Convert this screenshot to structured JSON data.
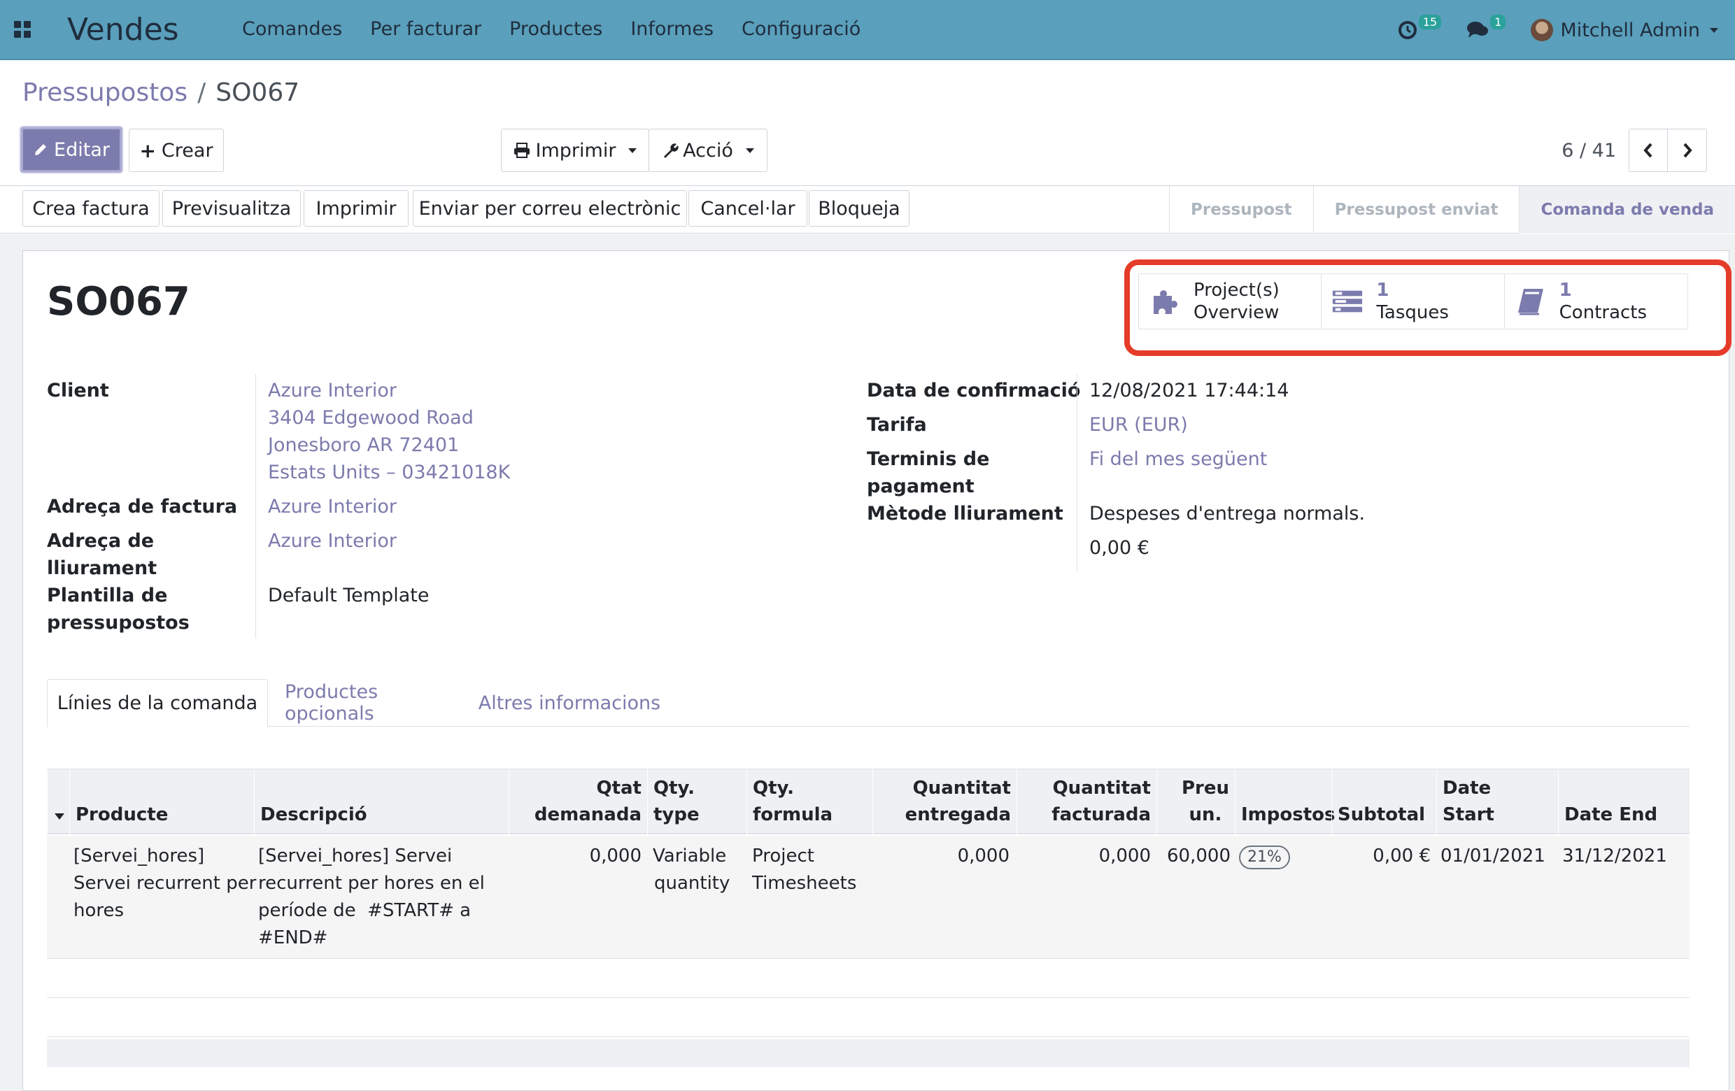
{
  "navbar": {
    "app_name": "Vendes",
    "menu": [
      "Comandes",
      "Per facturar",
      "Productes",
      "Informes",
      "Configuració"
    ],
    "activity_count": "15",
    "message_count": "1",
    "user_name": "Mitchell Admin"
  },
  "breadcrumb": {
    "parent": "Pressupostos",
    "separator": "/",
    "current": "SO067"
  },
  "actions": {
    "edit": "Editar",
    "create": "Crear",
    "print": "Imprimir",
    "action": "Acció"
  },
  "pager": {
    "value": "6 / 41"
  },
  "statusbar": {
    "buttons": [
      "Crea factura",
      "Previsualitza",
      "Imprimir",
      "Enviar per correu electrònic",
      "Cancel·lar",
      "Bloqueja"
    ],
    "stages": [
      "Pressupost",
      "Pressupost enviat",
      "Comanda de venda"
    ],
    "active_stage": "Comanda de venda"
  },
  "record": {
    "name": "SO067"
  },
  "smart_buttons": [
    {
      "line1": "Project(s)",
      "line2": "Overview",
      "icon": "puzzle-icon"
    },
    {
      "value": "1",
      "label": "Tasques",
      "icon": "tasks-icon"
    },
    {
      "value": "1",
      "label": "Contracts",
      "icon": "book-icon"
    }
  ],
  "fields_left": {
    "client_label": "Client",
    "client_lines": [
      "Azure Interior",
      "3404 Edgewood Road",
      "Jonesboro AR 72401",
      "Estats Units – 03421018K"
    ],
    "invoice_address_label": "Adreça de factura",
    "invoice_address": "Azure Interior",
    "delivery_address_label_1": "Adreça de",
    "delivery_address_label_2": "lliurament",
    "delivery_address": "Azure Interior",
    "template_label_1": "Plantilla de",
    "template_label_2": "pressupostos",
    "template": "Default Template"
  },
  "fields_right": {
    "confirmation_date_label": "Data de confirmació",
    "confirmation_date": "12/08/2021 17:44:14",
    "pricelist_label": "Tarifa",
    "pricelist": "EUR (EUR)",
    "payment_terms_label_1": "Terminis de",
    "payment_terms_label_2": "pagament",
    "payment_terms": "Fi del mes següent",
    "delivery_method_label": "Mètode lliurament",
    "delivery_method": "Despeses d'entrega normals.",
    "delivery_amount": "0,00 €"
  },
  "tabs": [
    "Línies de la comanda",
    "Productes opcionals",
    "Altres informacions"
  ],
  "order_lines": {
    "headers": {
      "product": "Producte",
      "description": "Descripció",
      "qty_ordered_1": "Qtat",
      "qty_ordered_2": "demanada",
      "qty_type_1": "Qty.",
      "qty_type_2": "type",
      "qty_formula_1": "Qty.",
      "qty_formula_2": "formula",
      "delivered_1": "Quantitat",
      "delivered_2": "entregada",
      "invoiced_1": "Quantitat",
      "invoiced_2": "facturada",
      "price_1": "Preu",
      "price_2": "un.",
      "taxes": "Impostos",
      "subtotal": "Subtotal",
      "date_start_1": "Date",
      "date_start_2": "Start",
      "date_end": "Date End"
    },
    "rows": [
      {
        "product": [
          "[Servei_hores]",
          "Servei recurrent per",
          "hores"
        ],
        "description": [
          "[Servei_hores] Servei",
          "recurrent per hores en el",
          "període de  #START# a",
          "#END#"
        ],
        "qty_ordered": "0,000",
        "qty_type": [
          "Variable",
          "quantity"
        ],
        "qty_formula": [
          "Project",
          "Timesheets"
        ],
        "delivered": "0,000",
        "invoiced": "0,000",
        "price": "60,000",
        "tax": "21%",
        "subtotal": "0,00 €",
        "date_start": "01/01/2021",
        "date_end": "31/12/2021"
      }
    ]
  },
  "colors": {
    "navbar": "#5a9fbb",
    "primary": "#7c7bad",
    "highlight": "#e53c29"
  }
}
